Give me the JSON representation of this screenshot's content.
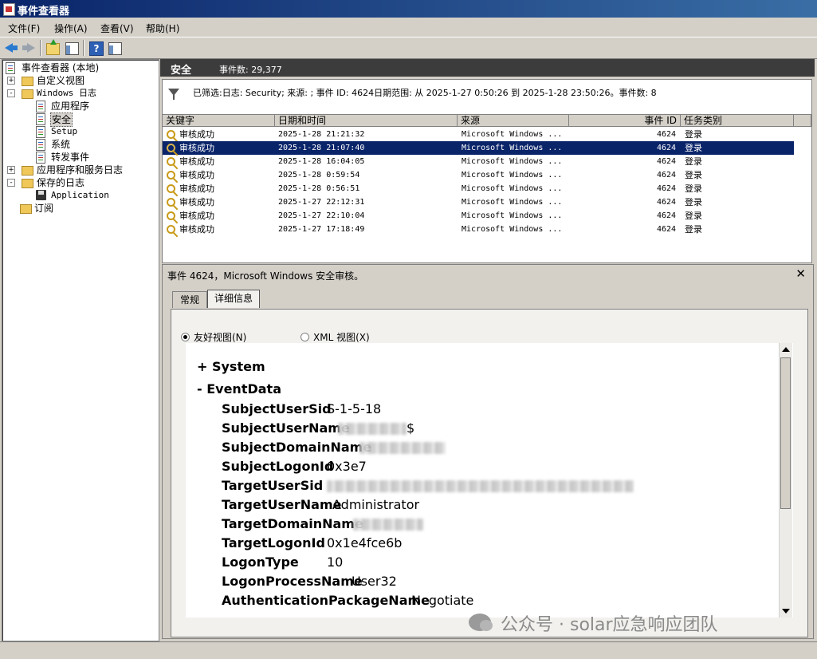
{
  "window": {
    "title": "事件查看器"
  },
  "menu": [
    "文件(F)",
    "操作(A)",
    "查看(V)",
    "帮助(H)"
  ],
  "tree": [
    {
      "label": "事件查看器 (本地)",
      "icon": "event-viewer-icon"
    },
    {
      "label": "自定义视图",
      "icon": "folder-icon"
    },
    {
      "label": "Windows 日志",
      "icon": "folder-icon"
    },
    {
      "label": "应用程序",
      "icon": "log-icon"
    },
    {
      "label": "安全",
      "icon": "log-icon"
    },
    {
      "label": "Setup",
      "icon": "log-icon"
    },
    {
      "label": "系统",
      "icon": "log-icon"
    },
    {
      "label": "转发事件",
      "icon": "log-icon"
    },
    {
      "label": "应用程序和服务日志",
      "icon": "folder-icon"
    },
    {
      "label": "保存的日志",
      "icon": "folder-icon"
    },
    {
      "label": "Application",
      "icon": "disk-icon"
    },
    {
      "label": "订阅",
      "icon": "subscription-icon"
    }
  ],
  "header": {
    "title": "安全",
    "count": "事件数: 29,377"
  },
  "filter": {
    "text": "已筛选:日志: Security; 来源: ; 事件 ID: 4624日期范围: 从 2025-1-27 0:50:26 到 2025-1-28 23:50:26。事件数: 8"
  },
  "columns": [
    "关键字",
    "日期和时间",
    "来源",
    "事件 ID",
    "任务类别"
  ],
  "events": [
    {
      "keyword": "审核成功",
      "datetime": "2025-1-28 21:21:32",
      "source": "Microsoft Windows ...",
      "id": "4624",
      "category": "登录"
    },
    {
      "keyword": "审核成功",
      "datetime": "2025-1-28 21:07:40",
      "source": "Microsoft Windows ...",
      "id": "4624",
      "category": "登录"
    },
    {
      "keyword": "审核成功",
      "datetime": "2025-1-28 16:04:05",
      "source": "Microsoft Windows ...",
      "id": "4624",
      "category": "登录"
    },
    {
      "keyword": "审核成功",
      "datetime": "2025-1-28 0:59:54",
      "source": "Microsoft Windows ...",
      "id": "4624",
      "category": "登录"
    },
    {
      "keyword": "审核成功",
      "datetime": "2025-1-28 0:56:51",
      "source": "Microsoft Windows ...",
      "id": "4624",
      "category": "登录"
    },
    {
      "keyword": "审核成功",
      "datetime": "2025-1-27 22:12:31",
      "source": "Microsoft Windows ...",
      "id": "4624",
      "category": "登录"
    },
    {
      "keyword": "审核成功",
      "datetime": "2025-1-27 22:10:04",
      "source": "Microsoft Windows ...",
      "id": "4624",
      "category": "登录"
    },
    {
      "keyword": "审核成功",
      "datetime": "2025-1-27 17:18:49",
      "source": "Microsoft Windows ...",
      "id": "4624",
      "category": "登录"
    }
  ],
  "detail": {
    "title": "事件 4624，Microsoft Windows 安全审核。",
    "tabs": [
      "常规",
      "详细信息"
    ],
    "view_friendly": "友好视图(N)",
    "view_xml": "XML 视图(X)",
    "sections": [
      "+ System",
      "- EventData"
    ],
    "fields": [
      {
        "key": "SubjectUserSid",
        "value": "S-1-5-18"
      },
      {
        "key": "SubjectUserName",
        "value": "$"
      },
      {
        "key": "SubjectDomainName",
        "value": ""
      },
      {
        "key": "SubjectLogonId",
        "value": "0x3e7"
      },
      {
        "key": "TargetUserSid",
        "value": ""
      },
      {
        "key": "TargetUserName",
        "value": "Administrator"
      },
      {
        "key": "TargetDomainName",
        "value": ""
      },
      {
        "key": "TargetLogonId",
        "value": "0x1e4fce6b"
      },
      {
        "key": "LogonType",
        "value": "10"
      },
      {
        "key": "LogonProcessName",
        "value": "User32"
      },
      {
        "key": "AuthenticationPackageName",
        "value": "Negotiate"
      }
    ]
  },
  "watermark": "公众号 · solar应急响应团队",
  "colors": {
    "selection": "#0a246a",
    "header_bg": "#3c3c3c",
    "title_gradient_start": "#0a246a"
  }
}
